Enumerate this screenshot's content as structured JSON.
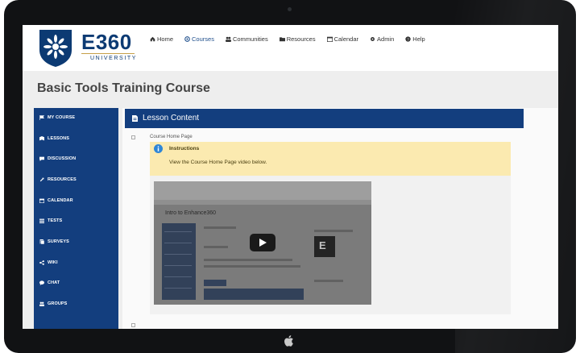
{
  "header": {
    "logo_text": "E360",
    "logo_subtext": "UNIVERSITY",
    "nav": [
      {
        "label": "Home",
        "icon": "home-icon"
      },
      {
        "label": "Courses",
        "icon": "courses-icon"
      },
      {
        "label": "Communities",
        "icon": "communities-icon"
      },
      {
        "label": "Resources",
        "icon": "folder-icon"
      },
      {
        "label": "Calendar",
        "icon": "calendar-icon"
      },
      {
        "label": "Admin",
        "icon": "gear-icon"
      },
      {
        "label": "Help",
        "icon": "help-icon"
      }
    ]
  },
  "page": {
    "title": "Basic Tools Training Course"
  },
  "sidebar": {
    "items": [
      {
        "label": "MY COURSE",
        "icon": "flag-icon"
      },
      {
        "label": "LESSONS",
        "icon": "lessons-icon"
      },
      {
        "label": "DISCUSSION",
        "icon": "discussion-icon"
      },
      {
        "label": "RESOURCES",
        "icon": "resources-icon"
      },
      {
        "label": "CALENDAR",
        "icon": "calendar-icon"
      },
      {
        "label": "TESTS",
        "icon": "tests-icon"
      },
      {
        "label": "SURVEYS",
        "icon": "surveys-icon"
      },
      {
        "label": "WIKI",
        "icon": "share-icon"
      },
      {
        "label": "CHAT",
        "icon": "chat-icon"
      },
      {
        "label": "GROUPS",
        "icon": "groups-icon"
      }
    ]
  },
  "lesson": {
    "header": "Lesson Content",
    "item_label": "Course Home Page",
    "instructions_title": "Instructions",
    "instructions_text": "View the Course Home Page video below.",
    "video_title": "Intro to Enhance360"
  },
  "colors": {
    "brand_blue": "#133e7e",
    "instructions_bg": "#fbeab0",
    "gold": "#c7a048"
  }
}
